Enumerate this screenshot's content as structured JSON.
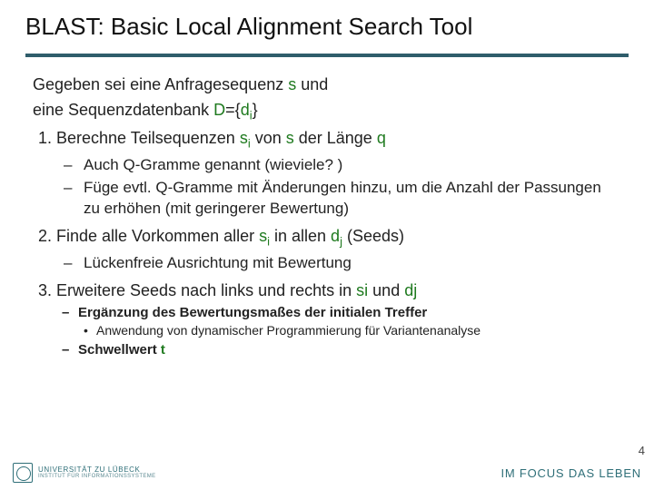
{
  "title": "BLAST: Basic Local Alignment Search Tool",
  "intro1_a": "Gegeben sei eine Anfragesequenz ",
  "intro1_s": "s",
  "intro1_b": " und",
  "intro2_a": "eine Sequenzdatenbank ",
  "intro2_D": "D",
  "intro2_eq": "={",
  "intro2_d": "d",
  "intro2_i": "i",
  "intro2_close": "}",
  "li1_a": "Berechne Teilsequenzen ",
  "li1_s": "s",
  "li1_i": "i",
  "li1_b": " von ",
  "li1_s2": "s",
  "li1_c": " der Länge ",
  "li1_q": "q",
  "li1_sub1": "Auch Q-Gramme genannt (wieviele? )",
  "li1_sub2": "Füge evtl. Q-Gramme mit Änderungen hinzu, um die Anzahl der Passungen zu erhöhen (mit geringerer Bewertung)",
  "li2_a": "Finde alle Vorkommen aller ",
  "li2_s": "s",
  "li2_i": "i",
  "li2_b": " in allen ",
  "li2_d": "d",
  "li2_j": "j",
  "li2_c": " (Seeds)",
  "li2_sub1": "Lückenfreie Ausrichtung mit Bewertung",
  "li3_a": "Erweitere Seeds nach links und rechts in ",
  "li3_si": "si",
  "li3_b": " und ",
  "li3_dj": "dj",
  "li3_sub1": "Ergänzung des Bewertungsmaßes der initialen Treffer",
  "li3_sub1_dot": "Anwendung von dynamischer Programmierung für Variantenanalyse",
  "li3_sub2_a": "Schwellwert ",
  "li3_sub2_t": "t",
  "footer": {
    "uni1": "UNIVERSITÄT ZU LÜBECK",
    "uni2": "INSTITUT FÜR INFORMATIONSSYSTEME",
    "tagline": "IM FOCUS DAS LEBEN"
  },
  "page": "4"
}
